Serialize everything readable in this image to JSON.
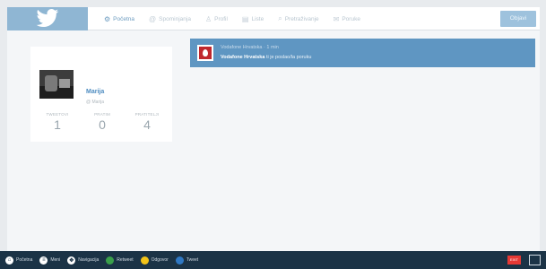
{
  "app": {
    "brand_color": "#8fb6d3",
    "accent_color": "#5f96c2"
  },
  "topbar": {
    "tabs": [
      {
        "icon": "home-icon",
        "glyph": "⚙",
        "label": "Početna",
        "active": true
      },
      {
        "icon": "mentions-icon",
        "glyph": "@",
        "label": "Spominjanja"
      },
      {
        "icon": "profile-icon",
        "glyph": "♙",
        "label": "Profil"
      },
      {
        "icon": "lists-icon",
        "glyph": "▤",
        "label": "Liste"
      },
      {
        "icon": "search-icon",
        "glyph": "⌕",
        "label": "Pretraživanje"
      },
      {
        "icon": "messages-icon",
        "glyph": "✉",
        "label": "Poruke"
      }
    ],
    "post_button": "Objavi"
  },
  "profile": {
    "name": "Marija",
    "handle": "@ Marija",
    "stats": [
      {
        "label": "TWEETOVI",
        "value": "1"
      },
      {
        "label": "PRATIM",
        "value": "0"
      },
      {
        "label": "PRATITELJI",
        "value": "4"
      }
    ]
  },
  "notification": {
    "line1": "Vodafone Hrvatska · 1 min",
    "line2_bold": "Vodafone Hrvatska",
    "line2_rest": " ti je poslao/la poruku"
  },
  "bottombar": {
    "items": [
      {
        "icon": "home-key-icon",
        "glyph": "⌂",
        "color": "#ffffff",
        "label": "Početna"
      },
      {
        "icon": "menu-key-icon",
        "glyph": "≡",
        "color": "#ffffff",
        "label": "Meni"
      },
      {
        "icon": "navigate-key-icon",
        "glyph": "✥",
        "color": "#ffffff",
        "label": "Navigacija"
      },
      {
        "icon": "green-key-icon",
        "glyph": "",
        "color": "#3aa04a",
        "label": "Retweet"
      },
      {
        "icon": "yellow-key-icon",
        "glyph": "",
        "color": "#f2c318",
        "label": "Odgovor"
      },
      {
        "icon": "blue-key-icon",
        "glyph": "",
        "color": "#2f78c4",
        "label": "Tweet"
      }
    ],
    "exit_label": "EXIT"
  }
}
